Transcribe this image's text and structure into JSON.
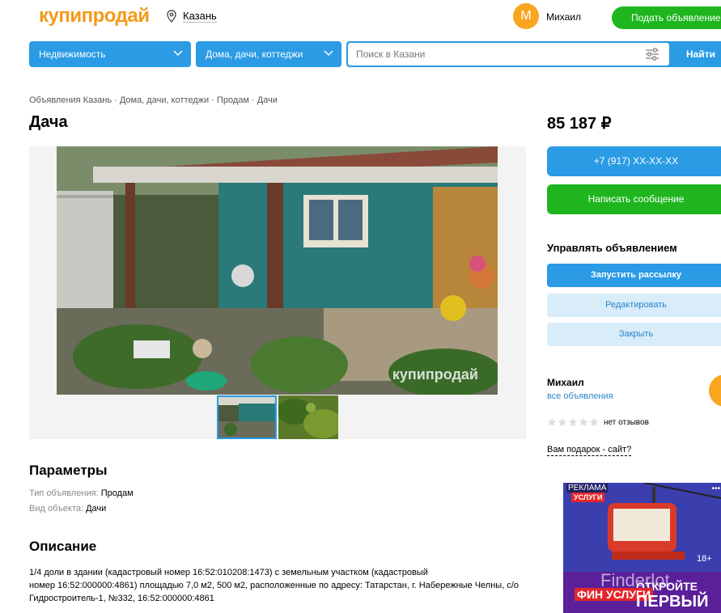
{
  "header": {
    "logo": "купипродай",
    "city": "Казань",
    "avatar_letter": "М",
    "user_name": "Михаил",
    "post_button": "Подать объявление"
  },
  "search": {
    "category": "Недвижимость",
    "subcategory": "Дома, дачи, коттеджи",
    "placeholder": "Поиск в Казани",
    "button": "Найти"
  },
  "breadcrumb": "Объявления Казань · Дома, дачи, коттеджи · Продам · Дачи",
  "listing": {
    "title": "Дача",
    "price": "85 187 ₽",
    "watermark": "купипродай"
  },
  "contact": {
    "phone": "+7 (917) XX-XX-XX",
    "message": "Написать сообщение"
  },
  "manage": {
    "title": "Управлять объявлением",
    "mailing": "Запустить рассылку",
    "edit": "Редактировать",
    "close": "Закрыть"
  },
  "seller": {
    "name": "Михаил",
    "all_ads": "все объявления",
    "reviews": "нет отзывов",
    "rating": 0,
    "gift": "Вам подарок - сайт?"
  },
  "params": {
    "title": "Параметры",
    "rows": [
      {
        "key": "Тип объявления:",
        "value": "Продам"
      },
      {
        "key": "Вид объекта:",
        "value": "Дачи"
      }
    ]
  },
  "description": {
    "title": "Описание",
    "line1": "1/4 доли в здании (кадастровый номер 16:52:010208:1473) с земельным участком (кадастровый",
    "line2": "номер 16:52:000000:4861) площадью 7,0 м2, 500 м2, расположенные по адресу: Татарстан, г. Набережные Челны, с/о",
    "line3": "Гидростроитель-1, №332, 16:52:000000:4861"
  },
  "ad": {
    "label": "РЕКЛАМА",
    "uslugi": "УСЛУГИ",
    "age": "18+",
    "fin": "ФИН УСЛУГИ",
    "open": "ОТКРОЙТЕ",
    "first": "ПЕРВЫЙ",
    "watermark": "Finderlot"
  },
  "colors": {
    "accent_blue": "#2a9be4",
    "green": "#1fb51f",
    "brand_orange": "#f39a1b"
  }
}
